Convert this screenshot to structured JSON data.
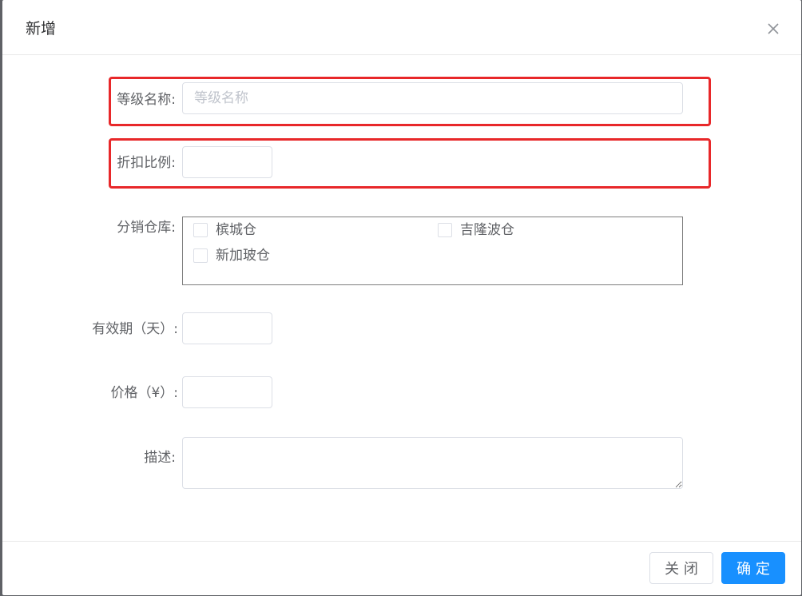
{
  "dialog": {
    "title": "新增",
    "close_icon": "close-icon"
  },
  "form": {
    "level_name": {
      "label": "等级名称:",
      "placeholder": "等级名称",
      "value": ""
    },
    "discount": {
      "label": "折扣比例:",
      "value": ""
    },
    "warehouses": {
      "label": "分销仓库:",
      "options": [
        {
          "label": "槟城仓",
          "checked": false
        },
        {
          "label": "吉隆波仓",
          "checked": false
        },
        {
          "label": "新加玻仓",
          "checked": false
        }
      ]
    },
    "validity": {
      "label": "有效期（天）:",
      "value": ""
    },
    "price": {
      "label": "价格（¥）:",
      "value": ""
    },
    "description": {
      "label": "描述:",
      "value": ""
    }
  },
  "footer": {
    "close_label": "关 闭",
    "confirm_label": "确 定"
  },
  "colors": {
    "primary": "#1890ff",
    "highlight": "#e8282a"
  }
}
